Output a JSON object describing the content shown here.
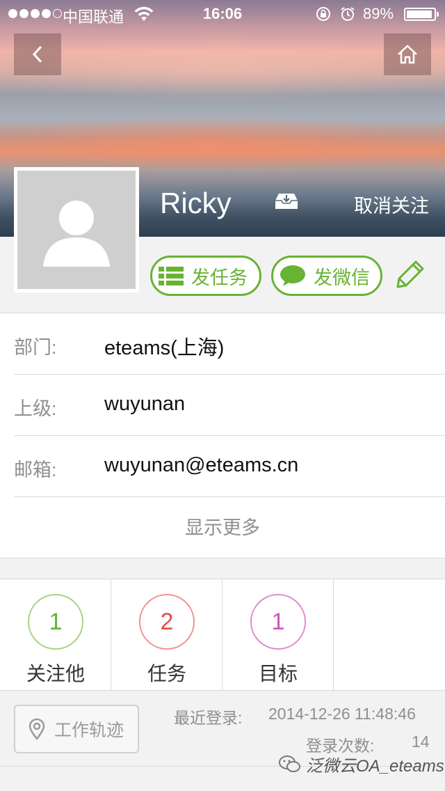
{
  "status_bar": {
    "carrier": "中国联通",
    "time": "16:06",
    "battery": "89%",
    "battery_level": 0.89
  },
  "profile": {
    "name": "Ricky",
    "unfollow_label": "取消关注"
  },
  "actions": {
    "task_label": "发任务",
    "chat_label": "发微信"
  },
  "info": {
    "rows": [
      {
        "label": "部门:",
        "value": "eteams(上海)"
      },
      {
        "label": "上级:",
        "value": "wuyunan"
      },
      {
        "label": "邮箱:",
        "value": "wuyunan@eteams.cn"
      }
    ],
    "show_more": "显示更多"
  },
  "stats": [
    {
      "value": "1",
      "label": "关注他",
      "color": "#a6d37e",
      "text_color": "#68b234"
    },
    {
      "value": "2",
      "label": "任务",
      "color": "#f0928f",
      "text_color": "#e0504d"
    },
    {
      "value": "1",
      "label": "目标",
      "color": "#e08ad0",
      "text_color": "#d052b8"
    }
  ],
  "footer": {
    "track_label": "工作轨迹",
    "last_login_label": "最近登录:",
    "last_login_time": "2014-12-26 11:48:46",
    "login_count_label": "登录次数:",
    "login_count": "14",
    "watermark": "泛微云OA_eteams"
  },
  "colors": {
    "accent": "#68b234",
    "divider": "#d9d9d9",
    "muted_text": "#8f8f8f"
  }
}
